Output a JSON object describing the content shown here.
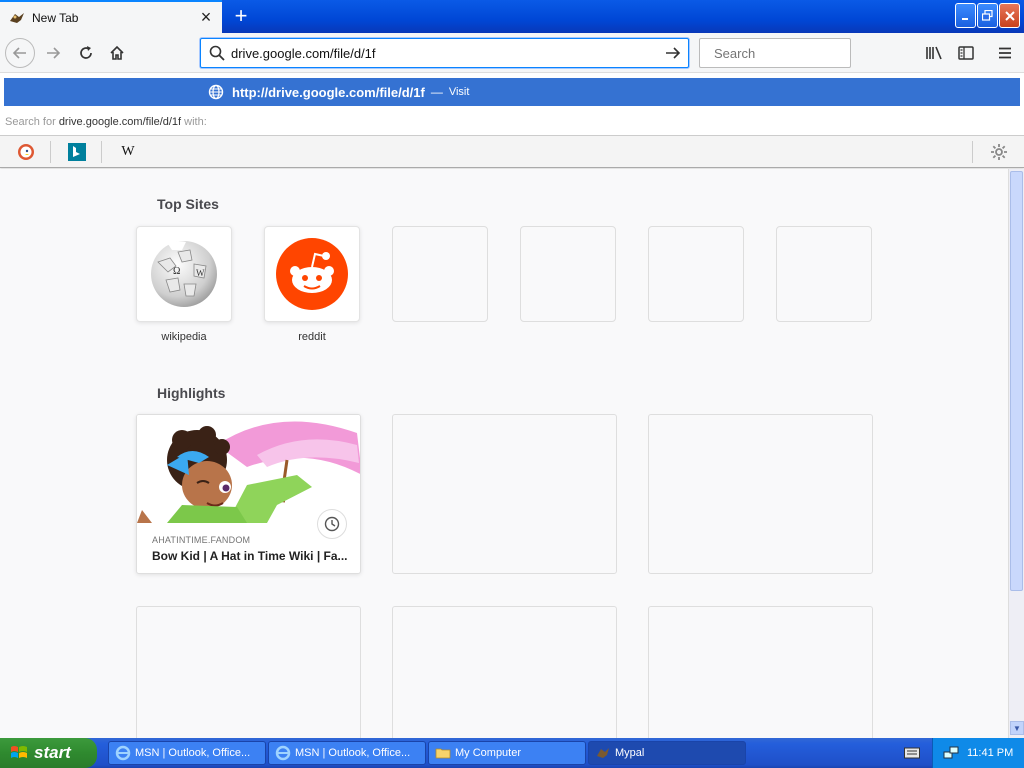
{
  "tab": {
    "title": "New Tab"
  },
  "window": {
    "minimize_icon": "minimize",
    "maximize_icon": "restore",
    "close_icon": "close"
  },
  "navbar": {
    "url_value": "drive.google.com/file/d/1f",
    "search_placeholder": "Search"
  },
  "dropdown": {
    "suggestion_url": "http://drive.google.com/file/d/1f",
    "suggestion_dash": "—",
    "suggestion_action": "Visit",
    "search_for_prefix": "Search for",
    "search_for_query": "drive.google.com/file/d/1f",
    "search_for_suffix": "with:"
  },
  "engines": [
    {
      "name": "duckduckgo-icon"
    },
    {
      "name": "bing-icon"
    },
    {
      "name": "wikipedia-icon",
      "glyph": "W"
    }
  ],
  "top_sites": {
    "title": "Top Sites",
    "tiles": [
      {
        "label": "wikipedia"
      },
      {
        "label": "reddit"
      }
    ]
  },
  "highlights": {
    "title": "Highlights",
    "card": {
      "source": "AHATINTIME.FANDOM",
      "headline": "Bow Kid | A Hat in Time Wiki | Fa..."
    }
  },
  "taskbar": {
    "start_label": "start",
    "tasks": [
      {
        "label": "MSN | Outlook, Office..."
      },
      {
        "label": "MSN | Outlook, Office..."
      },
      {
        "label": "My Computer"
      },
      {
        "label": "Mypal"
      }
    ],
    "clock": "11:41 PM"
  },
  "colors": {
    "accent": "#0a84ff",
    "suggestion_bg": "#3572d2",
    "reddit": "#ff4500",
    "xp_blue": "#245edb",
    "xp_green": "#2f8a2f"
  }
}
